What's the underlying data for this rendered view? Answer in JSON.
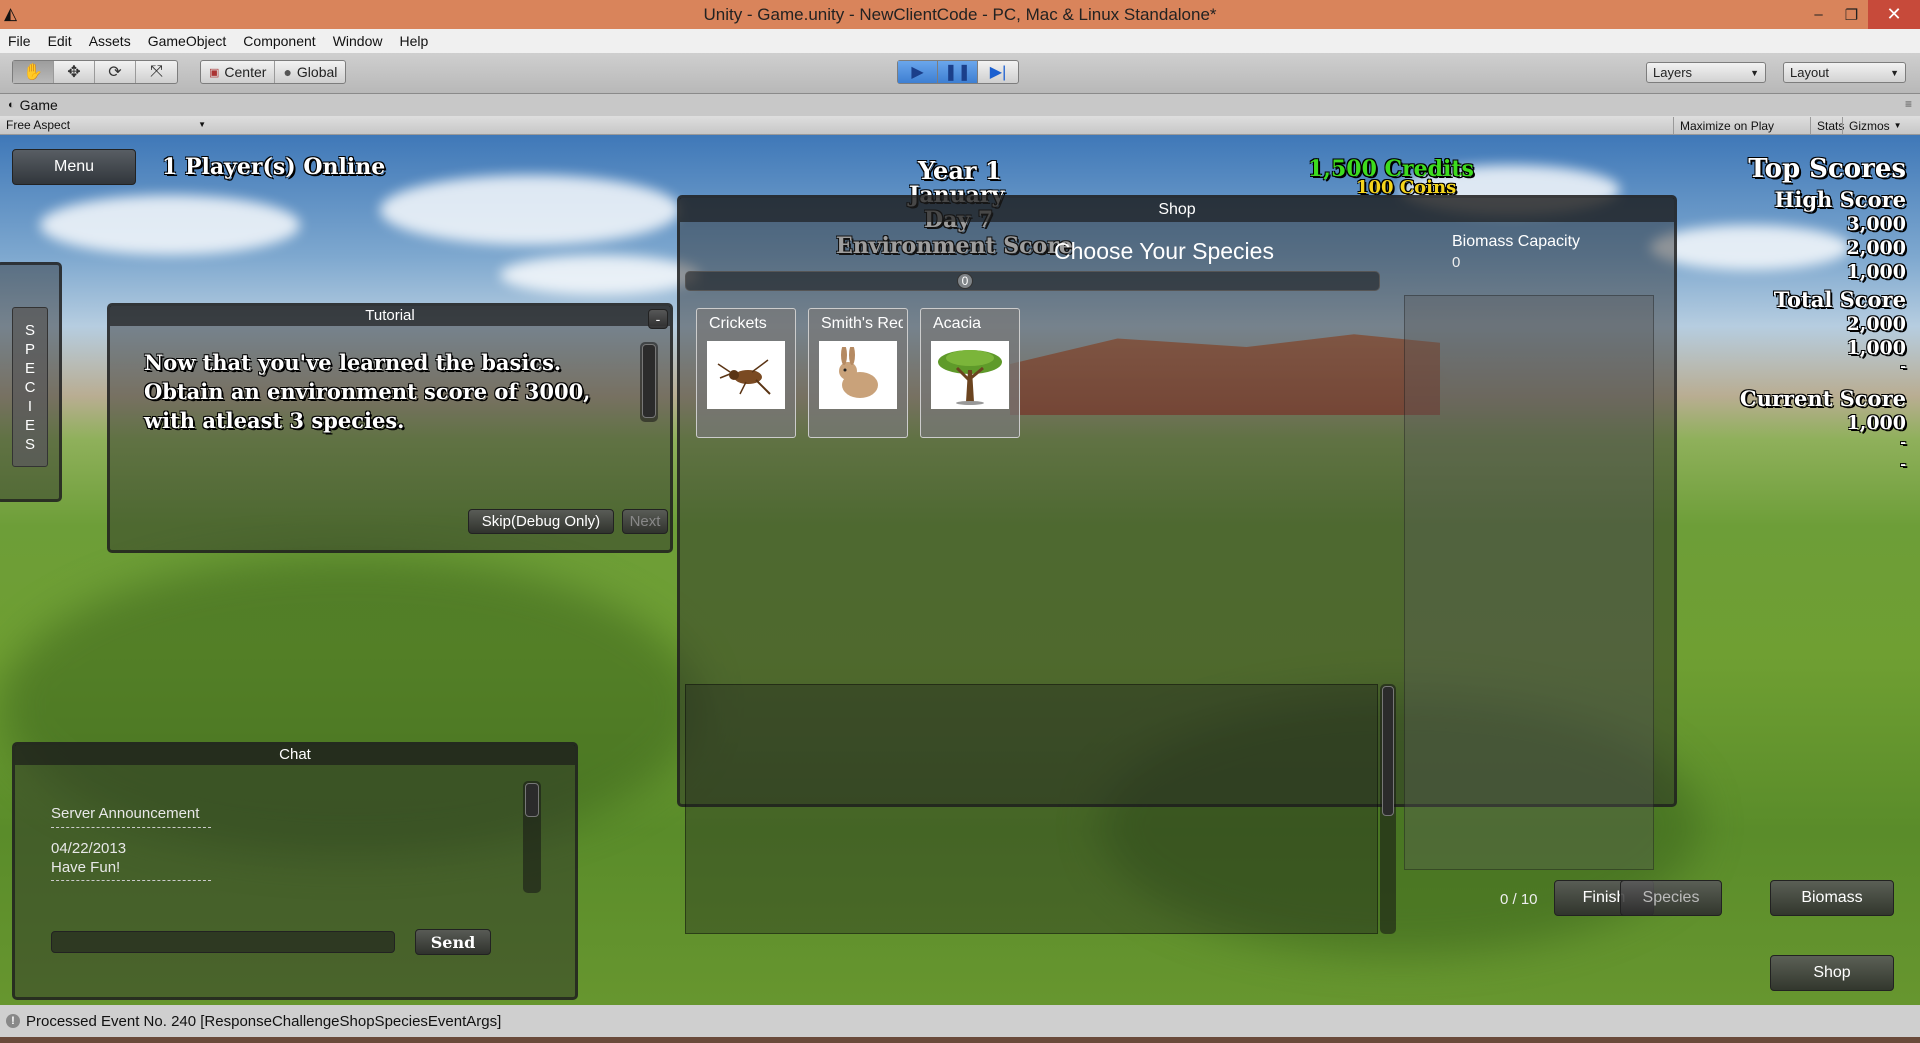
{
  "window": {
    "title": "Unity - Game.unity - NewClientCode - PC, Mac & Linux Standalone*",
    "logo_icon": "unity-logo-icon",
    "minimize": "–",
    "maximize": "❐",
    "close": "✕"
  },
  "menu": [
    "File",
    "Edit",
    "Assets",
    "GameObject",
    "Component",
    "Window",
    "Help"
  ],
  "toolbar": {
    "tools": [
      "hand-icon",
      "move-icon",
      "rotate-icon",
      "scale-icon"
    ],
    "pivot": "Center",
    "space": "Global",
    "play_controls": [
      "play-icon",
      "pause-icon",
      "step-icon"
    ],
    "layers": "Layers",
    "layout": "Layout"
  },
  "game_tab": {
    "label": "Game",
    "aspect": "Free Aspect",
    "maximize_on_play": "Maximize on Play",
    "stats": "Stats",
    "gizmos": "Gizmos"
  },
  "hud": {
    "menu_button": "Menu",
    "players_online": "1 Player(s) Online",
    "year": "Year 1",
    "month": "January",
    "day": "Day 7",
    "environment_score": "Environment Score",
    "credits": "1,500 Credits",
    "coins": "100 Coins",
    "species_tab": [
      "S",
      "P",
      "E",
      "C",
      "I",
      "E",
      "S"
    ]
  },
  "scores": {
    "top_title": "Top Scores",
    "high_title": "High Score",
    "high_values": [
      "3,000",
      "2,000",
      "1,000"
    ],
    "total_title": "Total Score",
    "total_values": [
      "2,000",
      "1,000",
      "-"
    ],
    "current_title": "Current Score",
    "current_values": [
      "1,000",
      "-",
      "-"
    ]
  },
  "tutorial": {
    "title": "Tutorial",
    "minimize": "-",
    "text": "Now that you've learned the basics. Obtain an environment score of 3000, with atleast 3 species.",
    "skip": "Skip(Debug Only)",
    "next": "Next"
  },
  "shop": {
    "title": "Shop",
    "heading": "Choose Your Species",
    "biomass_label": "Biomass Capacity",
    "biomass_value": "0",
    "progress_value": "0",
    "cards": [
      {
        "name": "Crickets",
        "icon": "cricket-icon"
      },
      {
        "name": "Smith's Red Rock Rabbit",
        "icon": "rabbit-icon"
      },
      {
        "name": "Acacia",
        "icon": "acacia-tree-icon"
      }
    ],
    "count": "0 / 10",
    "finish": "Finish"
  },
  "right_buttons": {
    "species": "Species",
    "biomass": "Biomass",
    "shop": "Shop"
  },
  "chat": {
    "title": "Chat",
    "announcement": "Server Announcement",
    "date": "04/22/2013",
    "message": "Have Fun!",
    "send": "Send",
    "input_value": ""
  },
  "status": {
    "icon": "info-icon",
    "text": "Processed Event No. 240 [ResponseChallengeShopSpeciesEventArgs]"
  },
  "colors": {
    "titlebar": "#d9845b",
    "credits": "#3ddc1e",
    "coins": "#f5d51c"
  }
}
